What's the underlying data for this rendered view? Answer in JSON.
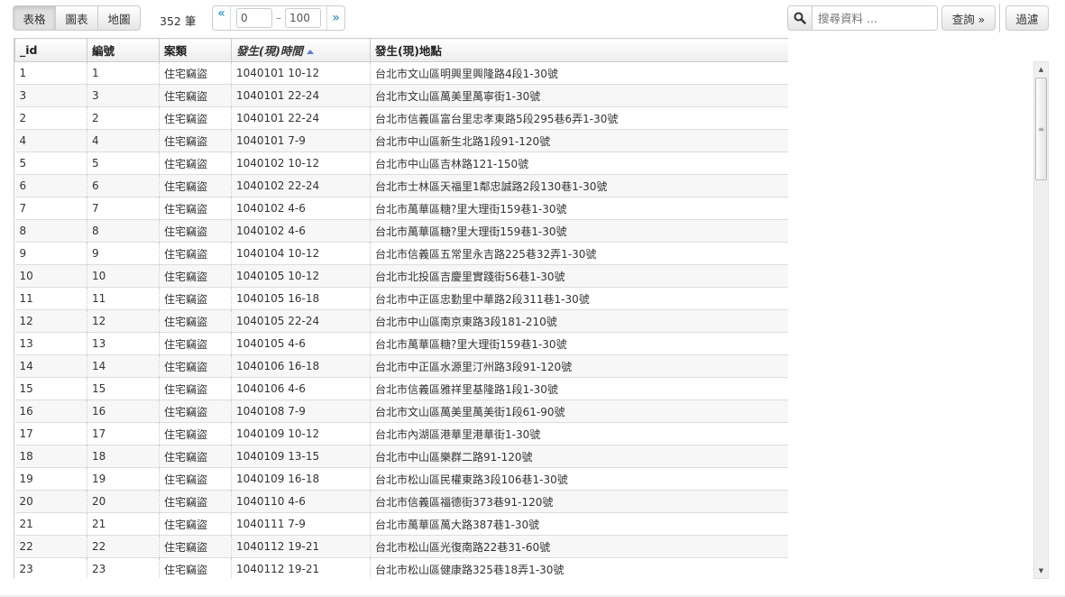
{
  "toolbar": {
    "views": [
      "表格",
      "圖表",
      "地圖"
    ],
    "active_view": "表格",
    "count_label": "352 筆",
    "pager": {
      "prev": "«",
      "from": "0",
      "to": "100",
      "dash": "–",
      "next": "»"
    },
    "search": {
      "placeholder": "搜尋資料 ...",
      "icon": "search-icon"
    },
    "query_label": "查詢 »",
    "filter_label": "過濾"
  },
  "table": {
    "columns": [
      "_id",
      "編號",
      "案類",
      "發生(現)時間",
      "發生(現)地點"
    ],
    "sorted_column": "發生(現)時間",
    "sort_direction": "ascending",
    "rows": [
      [
        "1",
        "1",
        "住宅竊盜",
        "1040101 10-12",
        "台北市文山區明興里興隆路4段1-30號"
      ],
      [
        "3",
        "3",
        "住宅竊盜",
        "1040101 22-24",
        "台北市文山區萬美里萬寧街1-30號"
      ],
      [
        "2",
        "2",
        "住宅竊盜",
        "1040101 22-24",
        "台北市信義區富台里忠孝東路5段295巷6弄1-30號"
      ],
      [
        "4",
        "4",
        "住宅竊盜",
        "1040101 7-9",
        "台北市中山區新生北路1段91-120號"
      ],
      [
        "5",
        "5",
        "住宅竊盜",
        "1040102 10-12",
        "台北市中山區吉林路121-150號"
      ],
      [
        "6",
        "6",
        "住宅竊盜",
        "1040102 22-24",
        "台北市士林區天福里1鄰忠誠路2段130巷1-30號"
      ],
      [
        "7",
        "7",
        "住宅竊盜",
        "1040102 4-6",
        "台北市萬華區糖?里大理街159巷1-30號"
      ],
      [
        "8",
        "8",
        "住宅竊盜",
        "1040102 4-6",
        "台北市萬華區糖?里大理街159巷1-30號"
      ],
      [
        "9",
        "9",
        "住宅竊盜",
        "1040104 10-12",
        "台北市信義區五常里永吉路225巷32弄1-30號"
      ],
      [
        "10",
        "10",
        "住宅竊盜",
        "1040105 10-12",
        "台北市北投區吉慶里實踐街56巷1-30號"
      ],
      [
        "11",
        "11",
        "住宅竊盜",
        "1040105 16-18",
        "台北市中正區忠勤里中華路2段311巷1-30號"
      ],
      [
        "12",
        "12",
        "住宅竊盜",
        "1040105 22-24",
        "台北市中山區南京東路3段181-210號"
      ],
      [
        "13",
        "13",
        "住宅竊盜",
        "1040105 4-6",
        "台北市萬華區糖?里大理街159巷1-30號"
      ],
      [
        "14",
        "14",
        "住宅竊盜",
        "1040106 16-18",
        "台北市中正區水源里汀州路3段91-120號"
      ],
      [
        "15",
        "15",
        "住宅竊盜",
        "1040106 4-6",
        "台北市信義區雅祥里基隆路1段1-30號"
      ],
      [
        "16",
        "16",
        "住宅竊盜",
        "1040108 7-9",
        "台北市文山區萬美里萬美街1段61-90號"
      ],
      [
        "17",
        "17",
        "住宅竊盜",
        "1040109 10-12",
        "台北市內湖區港華里港華街1-30號"
      ],
      [
        "18",
        "18",
        "住宅竊盜",
        "1040109 13-15",
        "台北市中山區樂群二路91-120號"
      ],
      [
        "19",
        "19",
        "住宅竊盜",
        "1040109 16-18",
        "台北市松山區民權東路3段106巷1-30號"
      ],
      [
        "20",
        "20",
        "住宅竊盜",
        "1040110 4-6",
        "台北市信義區福德街373巷91-120號"
      ],
      [
        "21",
        "21",
        "住宅竊盜",
        "1040111 7-9",
        "台北市萬華區萬大路387巷1-30號"
      ],
      [
        "22",
        "22",
        "住宅竊盜",
        "1040112 19-21",
        "台北市松山區光復南路22巷31-60號"
      ],
      [
        "23",
        "23",
        "住宅竊盜",
        "1040112 19-21",
        "台北市松山區健康路325巷18弄1-30號"
      ]
    ]
  },
  "colors": {
    "link": "#0088cc",
    "sort_arrow": "#5a7cc9",
    "border": "#cccccc"
  }
}
